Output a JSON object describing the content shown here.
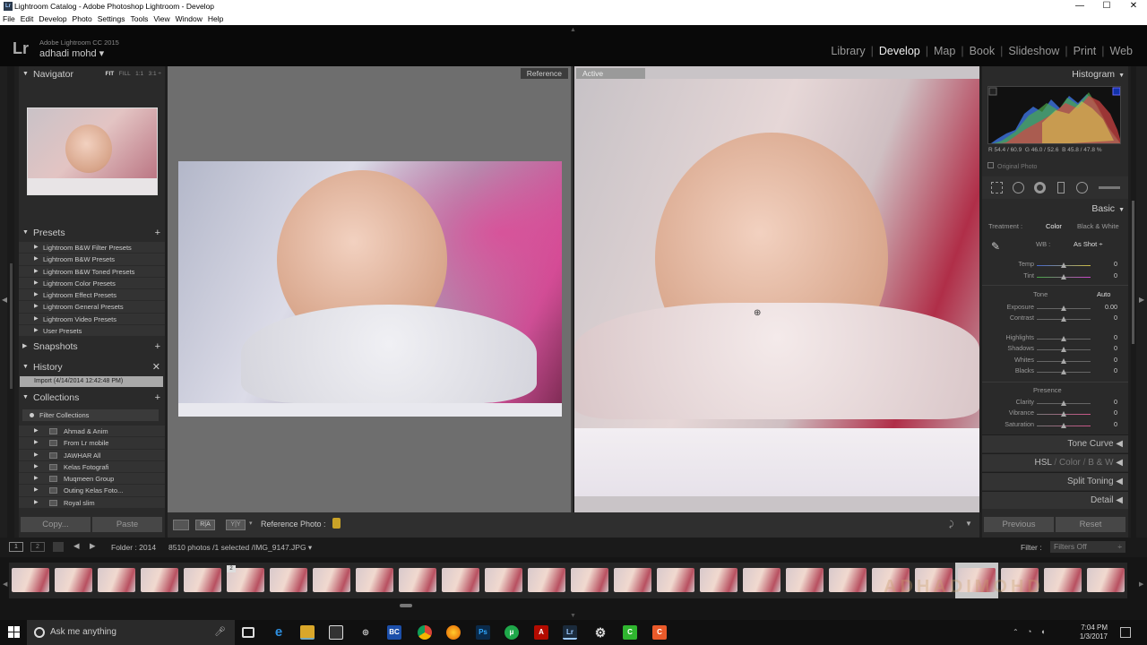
{
  "window": {
    "title": "Lightroom Catalog - Adobe Photoshop Lightroom - Develop",
    "controls": [
      "—",
      "☐",
      "✕"
    ]
  },
  "menu": [
    "File",
    "Edit",
    "Develop",
    "Photo",
    "Settings",
    "Tools",
    "View",
    "Window",
    "Help"
  ],
  "identity": {
    "logo": "Lr",
    "version": "Adobe Lightroom CC 2015",
    "user": "adhadi mohd ▾"
  },
  "modules": {
    "items": [
      "Library",
      "Develop",
      "Map",
      "Book",
      "Slideshow",
      "Print",
      "Web"
    ],
    "active": "Develop"
  },
  "navigator": {
    "title": "Navigator",
    "fit": "FIT",
    "fill": "FILL",
    "z1": "1:1",
    "z2": "3:1"
  },
  "presets": {
    "title": "Presets",
    "items": [
      "Lightroom B&W Filter Presets",
      "Lightroom B&W Presets",
      "Lightroom B&W Toned Presets",
      "Lightroom Color Presets",
      "Lightroom Effect Presets",
      "Lightroom General Presets",
      "Lightroom Video Presets",
      "User Presets"
    ]
  },
  "snapshots": {
    "title": "Snapshots"
  },
  "history": {
    "title": "History",
    "selected": "Import (4/14/2014 12:42:48 PM)",
    "close": "✕"
  },
  "collections": {
    "title": "Collections",
    "filter": "Filter Collections",
    "items": [
      "Ahmad & Anim",
      "From Lr mobile",
      "JAWHAR All",
      "Kelas Fotografi",
      "Muqmeen Group",
      "Outing Kelas Foto...",
      "Royal slim"
    ]
  },
  "left_buttons": {
    "copy": "Copy...",
    "paste": "Paste"
  },
  "viewer": {
    "reference_label": "Reference",
    "active_label": "Active"
  },
  "toolbar": {
    "reference_photo": "Reference Photo :"
  },
  "histogram": {
    "title": "Histogram",
    "readout_r": "R  54.4 / 60.9",
    "readout_g": "G  46.0 / 52.6",
    "readout_b": "B  45.8 / 47.8  %",
    "original": "Original Photo"
  },
  "basic": {
    "title": "Basic",
    "treatment_label": "Treatment :",
    "color": "Color",
    "bw": "Black & White",
    "wb_label": "WB :",
    "wb_value": "As Shot ÷",
    "tone_label": "Tone",
    "auto": "Auto",
    "presence_label": "Presence",
    "sliders": [
      {
        "label": "Temp",
        "value": "0"
      },
      {
        "label": "Tint",
        "value": "0"
      },
      {
        "label": "Exposure",
        "value": "0.00"
      },
      {
        "label": "Contrast",
        "value": "0"
      },
      {
        "label": "Highlights",
        "value": "0"
      },
      {
        "label": "Shadows",
        "value": "0"
      },
      {
        "label": "Whites",
        "value": "0"
      },
      {
        "label": "Blacks",
        "value": "0"
      },
      {
        "label": "Clarity",
        "value": "0"
      },
      {
        "label": "Vibrance",
        "value": "0"
      },
      {
        "label": "Saturation",
        "value": "0"
      }
    ]
  },
  "right_sections": {
    "tone_curve": "Tone Curve",
    "hsl": "HSL",
    "color": "Color",
    "bw": "B & W",
    "split": "Split Toning",
    "detail": "Detail"
  },
  "right_buttons": {
    "previous": "Previous",
    "reset": "Reset"
  },
  "filmstrip": {
    "view1": "1",
    "view2": "2",
    "folder": "Folder : 2014",
    "count": "8510 photos /1 selected /IMG_9147.JPG ▾",
    "filter_label": "Filter :",
    "filter_value": "Filters Off",
    "badge": "2",
    "watermark": "ADHADIMOHD"
  },
  "taskbar": {
    "search": "Ask me anything",
    "time": "7:04 PM",
    "date": "1/3/2017"
  }
}
